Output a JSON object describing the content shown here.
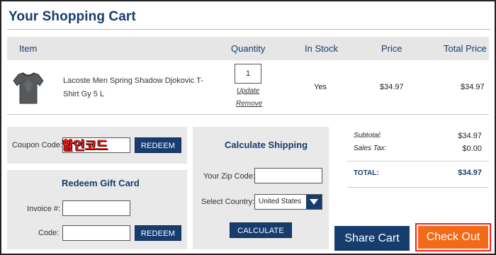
{
  "page": {
    "title": "Your Shopping Cart"
  },
  "table": {
    "headers": {
      "item": "Item",
      "quantity": "Quantity",
      "in_stock": "In Stock",
      "price": "Price",
      "total_price": "Total Price"
    },
    "rows": [
      {
        "name": "Lacoste Men Spring Shadow Djokovic T-Shirt Gy 5 L",
        "quantity": "1",
        "update_label": "Update",
        "remove_label": "Remove",
        "in_stock": "Yes",
        "price": "$34.97",
        "total": "$34.97"
      }
    ]
  },
  "coupon": {
    "label": "Coupon Code:",
    "value": "",
    "overlay_text": "할인코드",
    "redeem_label": "REDEEM"
  },
  "gift_card": {
    "title": "Redeem Gift Card",
    "invoice_label": "Invoice #:",
    "code_label": "Code:",
    "redeem_label": "REDEEM"
  },
  "shipping": {
    "title": "Calculate Shipping",
    "zip_label": "Your Zip Code:",
    "country_label": "Select Country:",
    "country_value": "United States",
    "calculate_label": "CALCULATE"
  },
  "summary": {
    "subtotal_label": "Subtotal:",
    "subtotal_value": "$34.97",
    "tax_label": "Sales Tax:",
    "tax_value": "$0.00",
    "total_label": "TOTAL:",
    "total_value": "$34.97"
  },
  "actions": {
    "share_label": "Share Cart",
    "checkout_label": "Check Out"
  },
  "colors": {
    "brand_navy": "#163d6e",
    "checkout_orange": "#f26a17",
    "highlight_red": "#ff1a1a",
    "panel_gray": "#e9e9e9"
  }
}
